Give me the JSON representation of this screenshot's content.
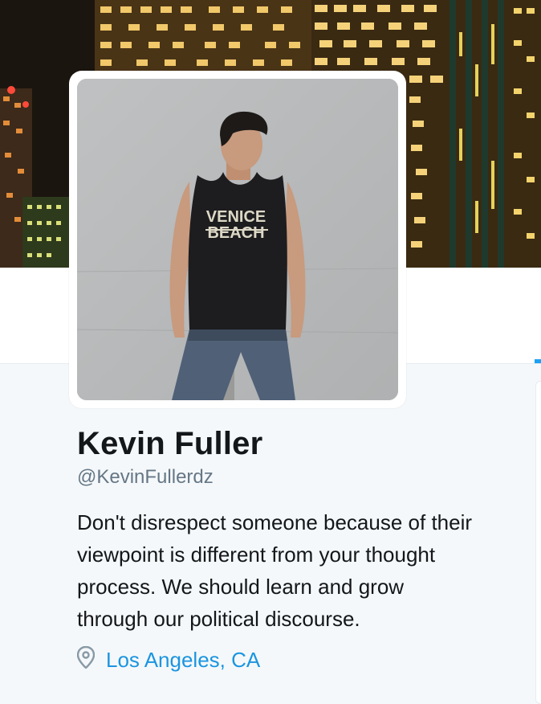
{
  "header": {
    "banner_icon": "city-skyline-night-photo"
  },
  "profile": {
    "avatar_icon": "profile-photo",
    "shirt_text_line1": "VENICE",
    "shirt_text_line2": "BEACH",
    "name": "Kevin Fuller",
    "handle": "@KevinFullerdz",
    "bio": "Don't disrespect someone because of their viewpoint is different from your thought process. We should learn and grow through our political discourse.",
    "location_icon": "map-pin-icon",
    "location": "Los Angeles, CA"
  },
  "colors": {
    "name": "#14171a",
    "handle": "#657786",
    "link": "#1b95e0",
    "accent": "#1da1f2",
    "background": "#f5f8fa"
  }
}
